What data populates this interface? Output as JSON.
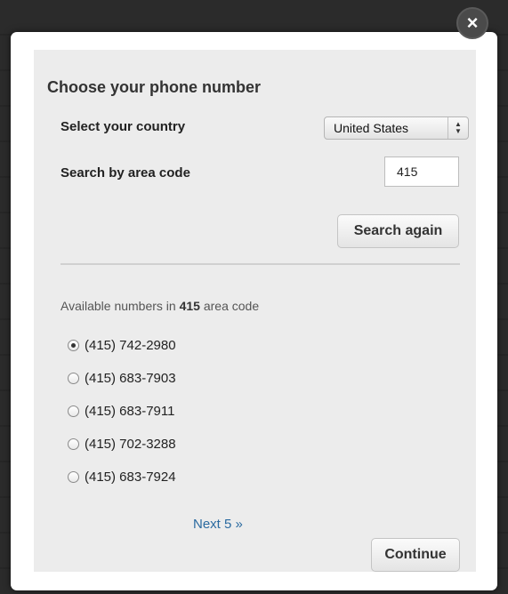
{
  "close_icon": "×",
  "dialog": {
    "title": "Choose your phone number",
    "country_label": "Select your country",
    "country_value": "United States",
    "area_label": "Search by area code",
    "area_value": "415",
    "search_button": "Search again",
    "available_prefix": "Available numbers in ",
    "available_code": "415",
    "available_suffix": " area code",
    "numbers": [
      {
        "label": "(415) 742-2980",
        "selected": true
      },
      {
        "label": "(415) 683-7903",
        "selected": false
      },
      {
        "label": "(415) 683-7911",
        "selected": false
      },
      {
        "label": "(415) 702-3288",
        "selected": false
      },
      {
        "label": "(415) 683-7924",
        "selected": false
      }
    ],
    "next_link": "Next 5 »",
    "continue_button": "Continue"
  },
  "colors": {
    "backdrop": "#2a2a2a",
    "panel": "#ececec",
    "link": "#2a6aa0"
  },
  "icons": {
    "close": "close-icon",
    "select_arrows": "up-down-arrows-icon",
    "radio": "radio-icon"
  }
}
